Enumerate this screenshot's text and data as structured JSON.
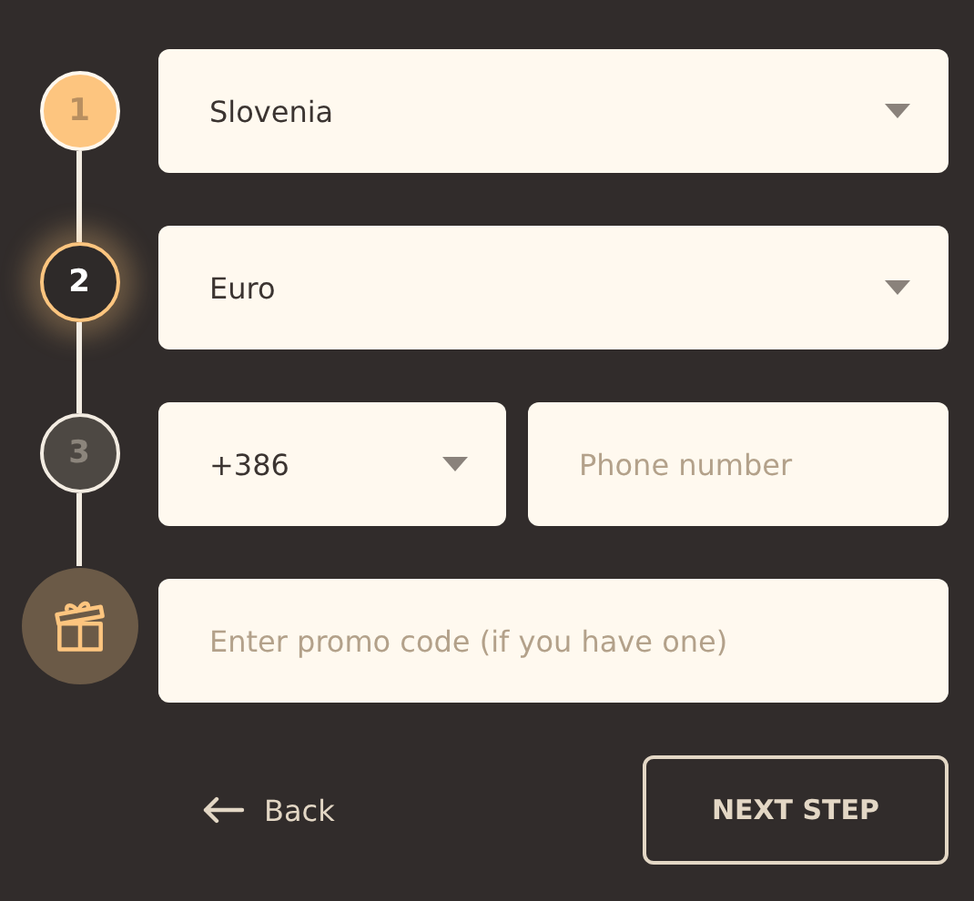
{
  "steps": [
    {
      "label": "1",
      "done": true,
      "selected": false
    },
    {
      "label": "2",
      "done": false,
      "selected": true
    },
    {
      "label": "3",
      "done": false,
      "selected": false
    }
  ],
  "country": {
    "value": "Slovenia"
  },
  "currency": {
    "value": "Euro"
  },
  "phone_code": {
    "value": "+386"
  },
  "phone": {
    "placeholder": "Phone number"
  },
  "promo": {
    "placeholder": "Enter promo code (if you have one)"
  },
  "back_button": {
    "label": "Back"
  },
  "next_button": {
    "label": "NEXT STEP"
  }
}
